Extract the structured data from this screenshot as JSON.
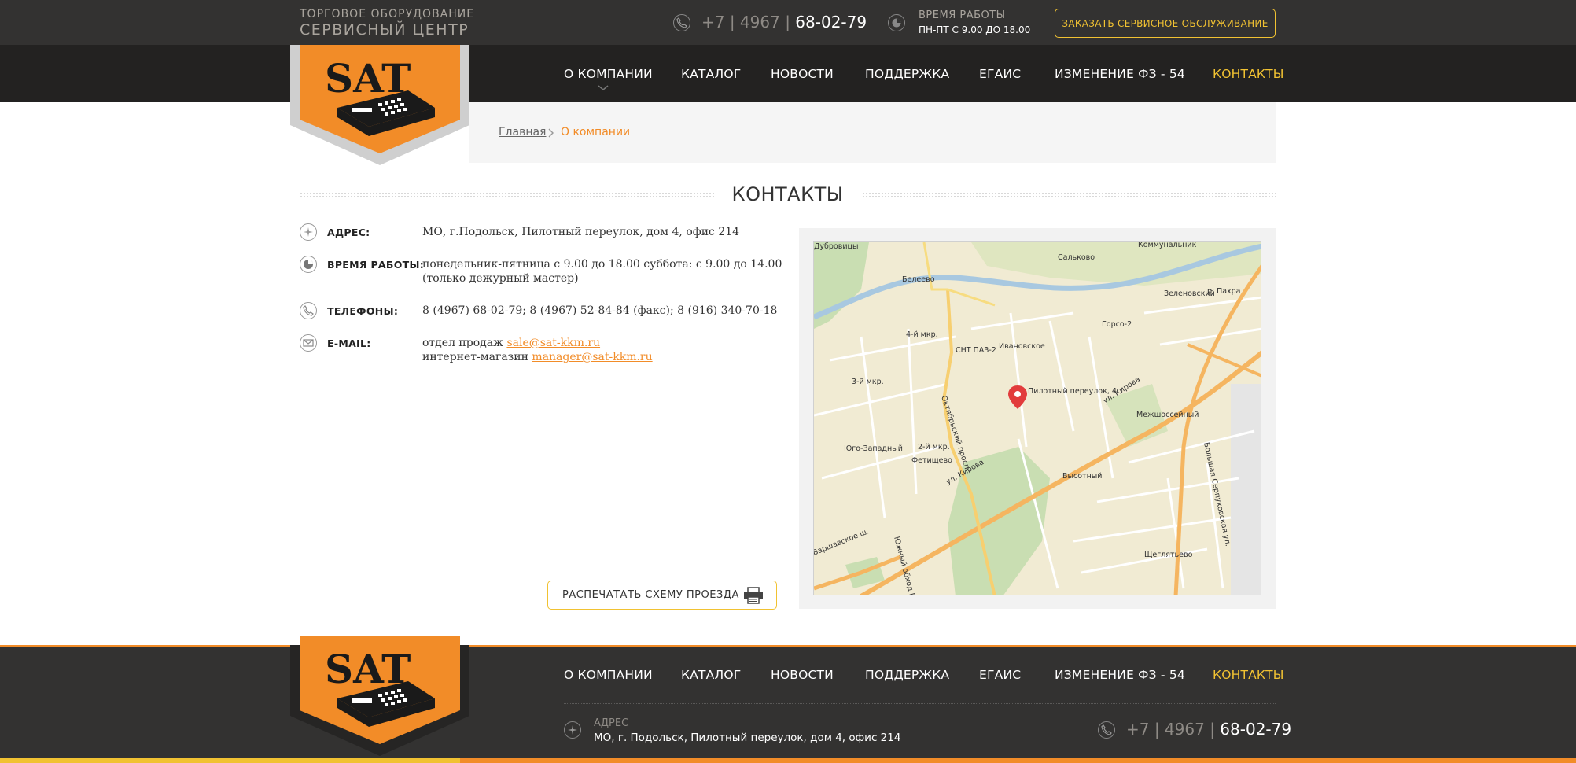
{
  "header": {
    "brand_line1": "ТОРГОВОЕ ОБОРУДОВАНИЕ",
    "brand_line2": "СЕРВИСНЫЙ ЦЕНТР",
    "phone_prefix": "+7 | 4967 | ",
    "phone_number": "68-02-79",
    "hours_title": "ВРЕМЯ РАБОТЫ",
    "hours_text": "ПН-ПТ  С 9.00 ДО 18.00",
    "service_button": "ЗАКАЗАТЬ СЕРВИСНОЕ ОБСЛУЖИВАНИЕ"
  },
  "nav": [
    {
      "label": "О КОМПАНИИ"
    },
    {
      "label": "КАТАЛОГ"
    },
    {
      "label": "НОВОСТИ"
    },
    {
      "label": "ПОДДЕРЖКА"
    },
    {
      "label": "ЕГАИС"
    },
    {
      "label": "ИЗМЕНЕНИЕ ФЗ - 54"
    },
    {
      "label": "КОНТАКТЫ"
    }
  ],
  "logo": {
    "text": "SAT"
  },
  "breadcrumb": {
    "home": "Главная",
    "current": "О компании"
  },
  "page": {
    "title": "КОНТАКТЫ"
  },
  "contacts": {
    "address_label": "АДРЕС:",
    "address": "МО, г.Подольск, Пилотный переулок, дом 4, офис 214",
    "hours_label": "ВРЕМЯ РАБОТЫ:",
    "hours_line1": "понедельник-пятница с 9.00 до 18.00 суббота: с 9.00 до 14.00",
    "hours_line2": "(только дежурный мастер)",
    "phones_label": "ТЕЛЕФОНЫ:",
    "phones": "8 (4967) 68-02-79;   8 (4967) 52-84-84 (факс);   8 (916) 340-70-18",
    "email_label": "E-MAIL:",
    "sales_prefix": "отдел продаж ",
    "sales_email": "sale@sat-kkm.ru",
    "shop_prefix": "интернет-магазин ",
    "shop_email": "manager@sat-kkm.ru",
    "print_button": "РАСПЕЧАТАТЬ СХЕМУ ПРОЕЗДА"
  },
  "map": {
    "labels": {
      "sal": "Сальково",
      "gor": "Горсо-2",
      "snt": "СНТ ПАЗ-2",
      "pin": "Пилотный переулок, 4",
      "kirova1": "ул. Кирова",
      "kirova2": "ул. Кирова",
      "mkr4": "4-й мкр.",
      "mkr3": "3-й мкр.",
      "mkr2": "2-й мкр.",
      "yuz": "Юго-Западный",
      "fet": "Фетищево",
      "vys": "Высотный",
      "mezh": "Межшоссейный",
      "bs": "Большая Серпуховская ул.",
      "okt": "Октябрьский просп.",
      "yuzh": "Южный обход Под",
      "varsh": "Варшавское ш.",
      "zel": "Зеленовский",
      "bel": "Белеево",
      "dub": "Дубровицы",
      "kom": "Коммунальник",
      "pakhra": "р. Пахра",
      "ivan": "Ивановское",
      "shch": "Щеглятьево"
    }
  },
  "footer": {
    "address_label": "АДРЕС",
    "address": "МО, г. Подольск, Пилотный переулок, дом 4, офис 214",
    "phone_prefix": "+7 | 4967 | ",
    "phone_number": "68-02-79"
  },
  "colors": {
    "accent_orange": "#f28c28",
    "accent_yellow": "#f1c232",
    "dark": "#232221"
  }
}
